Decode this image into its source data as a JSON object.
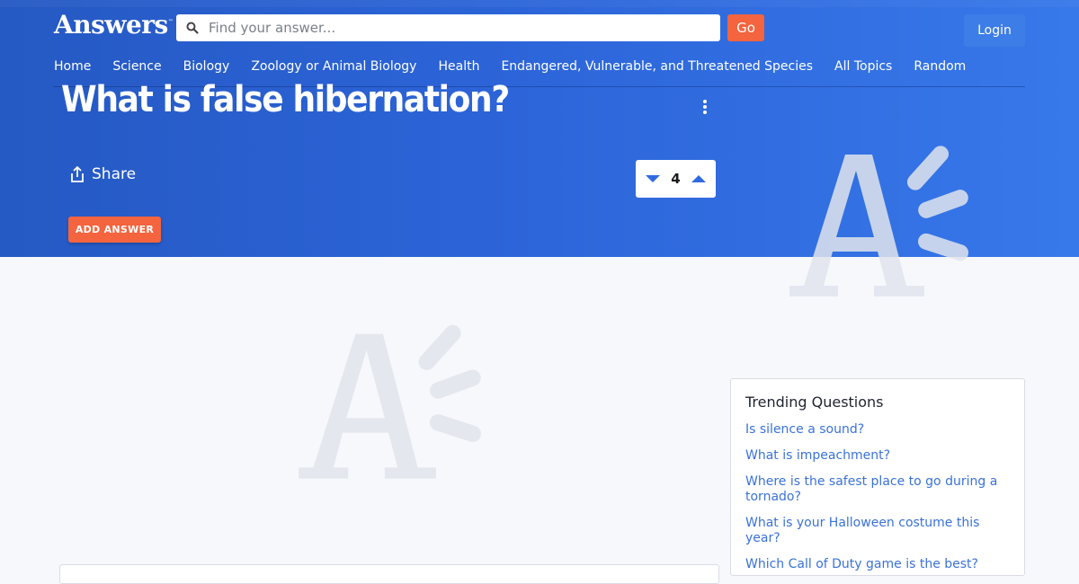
{
  "header": {
    "logo_text": "Answers",
    "logo_tm": "™",
    "search_placeholder": "Find your answer...",
    "search_value": "",
    "go_label": "Go",
    "login_label": "Login"
  },
  "nav": {
    "items": [
      {
        "label": "Home"
      },
      {
        "label": "Science"
      },
      {
        "label": "Biology"
      },
      {
        "label": "Zoology or Animal Biology"
      },
      {
        "label": "Health"
      },
      {
        "label": "Endangered, Vulnerable, and Threatened Species"
      },
      {
        "label": "All Topics"
      },
      {
        "label": "Random"
      }
    ]
  },
  "question": {
    "title": "What is false hibernation?",
    "share_label": "Share",
    "vote_count": "4",
    "add_answer_label": "ADD ANSWER"
  },
  "trending": {
    "heading": "Trending Questions",
    "items": [
      {
        "label": "Is silence a sound?"
      },
      {
        "label": "What is impeachment?"
      },
      {
        "label": "Where is the safest place to go during a tornado?"
      },
      {
        "label": "What is your Halloween costume this year?"
      },
      {
        "label": "Which Call of Duty game is the best?"
      }
    ]
  },
  "colors": {
    "hero_start": "#2559c3",
    "hero_end": "#3778ea",
    "accent_orange": "#f4643e",
    "link_blue": "#3a72d8",
    "page_bg": "#f6f8fc"
  },
  "icons": {
    "search": "search-icon",
    "share": "share-icon",
    "more": "more-vertical-icon",
    "vote_down": "caret-down-icon",
    "vote_up": "caret-up-icon",
    "watermark": "answers-logo-watermark"
  }
}
